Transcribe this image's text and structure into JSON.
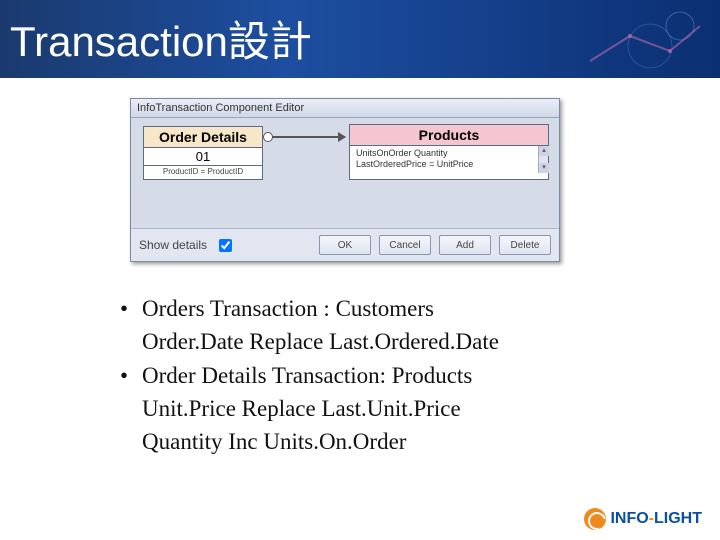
{
  "slide": {
    "title": "Transaction設計"
  },
  "editor": {
    "window_title": "InfoTransaction Component Editor",
    "order_details": {
      "header": "Order Details",
      "id": "01",
      "footer": "ProductID = ProductID"
    },
    "products": {
      "header": "Products",
      "line1": "UnitsOnOrder   Quantity",
      "line2": "LastOrderedPrice = UnitPrice"
    },
    "show_details_label": "Show details",
    "buttons": {
      "ok": "OK",
      "cancel": "Cancel",
      "add": "Add",
      "delete": "Delete"
    }
  },
  "bullets": {
    "b1": "Orders Transaction : Customers",
    "b1_cont": "Order.Date Replace Last.Ordered.Date",
    "b2": "Order Details Transaction: Products",
    "b2_cont1": "Unit.Price Replace Last.Unit.Price",
    "b2_cont2": "Quantity Inc Units.On.Order"
  },
  "logo": {
    "part1": "INFO",
    "part2": "LIGHT"
  }
}
